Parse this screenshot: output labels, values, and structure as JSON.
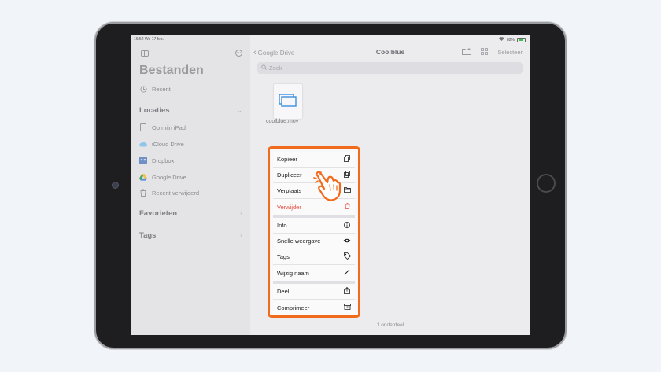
{
  "status_bar": {
    "time": "16:52",
    "date": "Wo 17 feb.",
    "battery": "82%"
  },
  "sidebar": {
    "title": "Bestanden",
    "recent": "Recent",
    "locations_header": "Locaties",
    "locations": [
      {
        "label": "Op mijn iPad",
        "icon": "ipad-icon"
      },
      {
        "label": "iCloud Drive",
        "icon": "icloud-icon"
      },
      {
        "label": "Dropbox",
        "icon": "dropbox-icon"
      },
      {
        "label": "Google Drive",
        "icon": "google-drive-icon"
      },
      {
        "label": "Recent verwijderd",
        "icon": "trash-icon"
      }
    ],
    "favorites_header": "Favorieten",
    "tags_header": "Tags"
  },
  "nav": {
    "back_label": "Google Drive",
    "title": "Coolblue",
    "select_label": "Selecteer"
  },
  "search": {
    "placeholder": "Zoek"
  },
  "file": {
    "name": "coolblue.mov"
  },
  "footer": {
    "count": "1 onderdeel"
  },
  "context_menu": {
    "group1": [
      {
        "label": "Kopieer",
        "icon": "copy-icon"
      },
      {
        "label": "Dupliceer",
        "icon": "duplicate-icon"
      },
      {
        "label": "Verplaats",
        "icon": "folder-icon"
      },
      {
        "label": "Verwijder",
        "icon": "trash-icon",
        "destructive": true
      }
    ],
    "group2": [
      {
        "label": "Info",
        "icon": "info-icon"
      },
      {
        "label": "Snelle weergave",
        "icon": "eye-icon"
      },
      {
        "label": "Tags",
        "icon": "tag-icon"
      },
      {
        "label": "Wijzig naam",
        "icon": "pencil-icon"
      }
    ],
    "group3": [
      {
        "label": "Deel",
        "icon": "share-icon"
      },
      {
        "label": "Comprimeer",
        "icon": "archive-icon"
      }
    ]
  },
  "colors": {
    "highlight": "#f26b1d",
    "destructive": "#e5483a",
    "device": "#1e1e20"
  }
}
